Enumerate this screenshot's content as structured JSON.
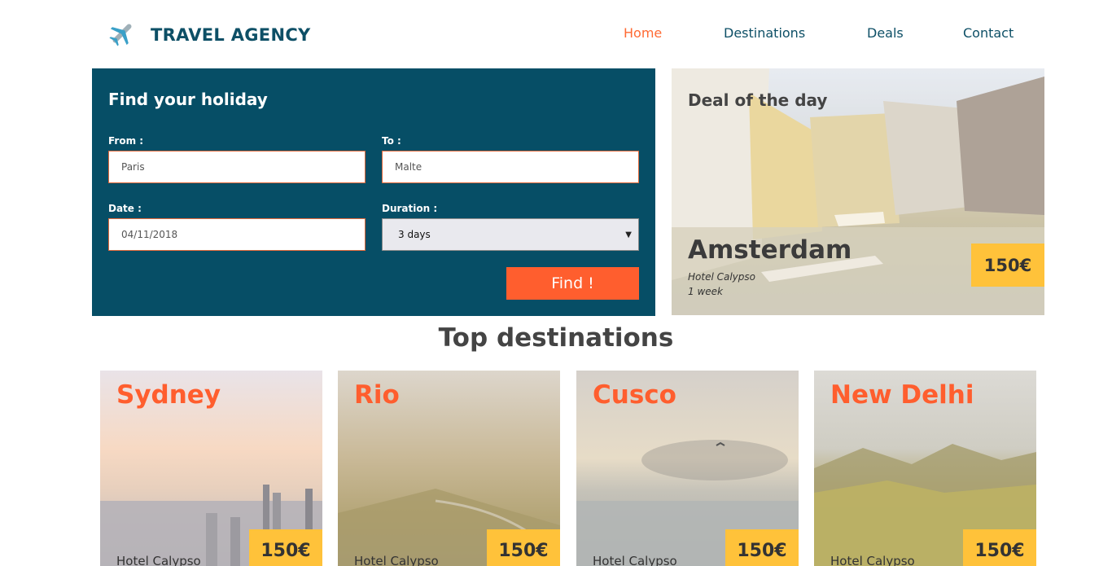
{
  "header": {
    "brand": "TRAVEL AGENCY",
    "logo_icon": "airplane-icon",
    "nav": [
      {
        "label": "Home",
        "active": true
      },
      {
        "label": "Destinations",
        "active": false
      },
      {
        "label": "Deals",
        "active": false
      },
      {
        "label": "Contact",
        "active": false
      }
    ]
  },
  "search": {
    "title": "Find your holiday",
    "from_label": "From :",
    "from_value": "Paris",
    "to_label": "To :",
    "to_value": "Malte",
    "date_label": "Date :",
    "date_value": "04/11/2018",
    "duration_label": "Duration :",
    "duration_value": "3 days",
    "button": "Find !"
  },
  "deal": {
    "title": "Deal of the day",
    "city": "Amsterdam",
    "hotel": "Hotel Calypso",
    "duration": "1 week",
    "price": "150€"
  },
  "destinations": {
    "title": "Top destinations",
    "items": [
      {
        "name": "Sydney",
        "hotel": "Hotel Calypso",
        "price": "150€"
      },
      {
        "name": "Rio",
        "hotel": "Hotel Calypso",
        "price": "150€"
      },
      {
        "name": "Cusco",
        "hotel": "Hotel Calypso",
        "price": "150€"
      },
      {
        "name": "New Delhi",
        "hotel": "Hotel Calypso",
        "price": "150€"
      }
    ]
  },
  "colors": {
    "brand_dark": "#064e66",
    "accent_orange": "#ff5e2e",
    "price_yellow": "#ffc23a"
  }
}
